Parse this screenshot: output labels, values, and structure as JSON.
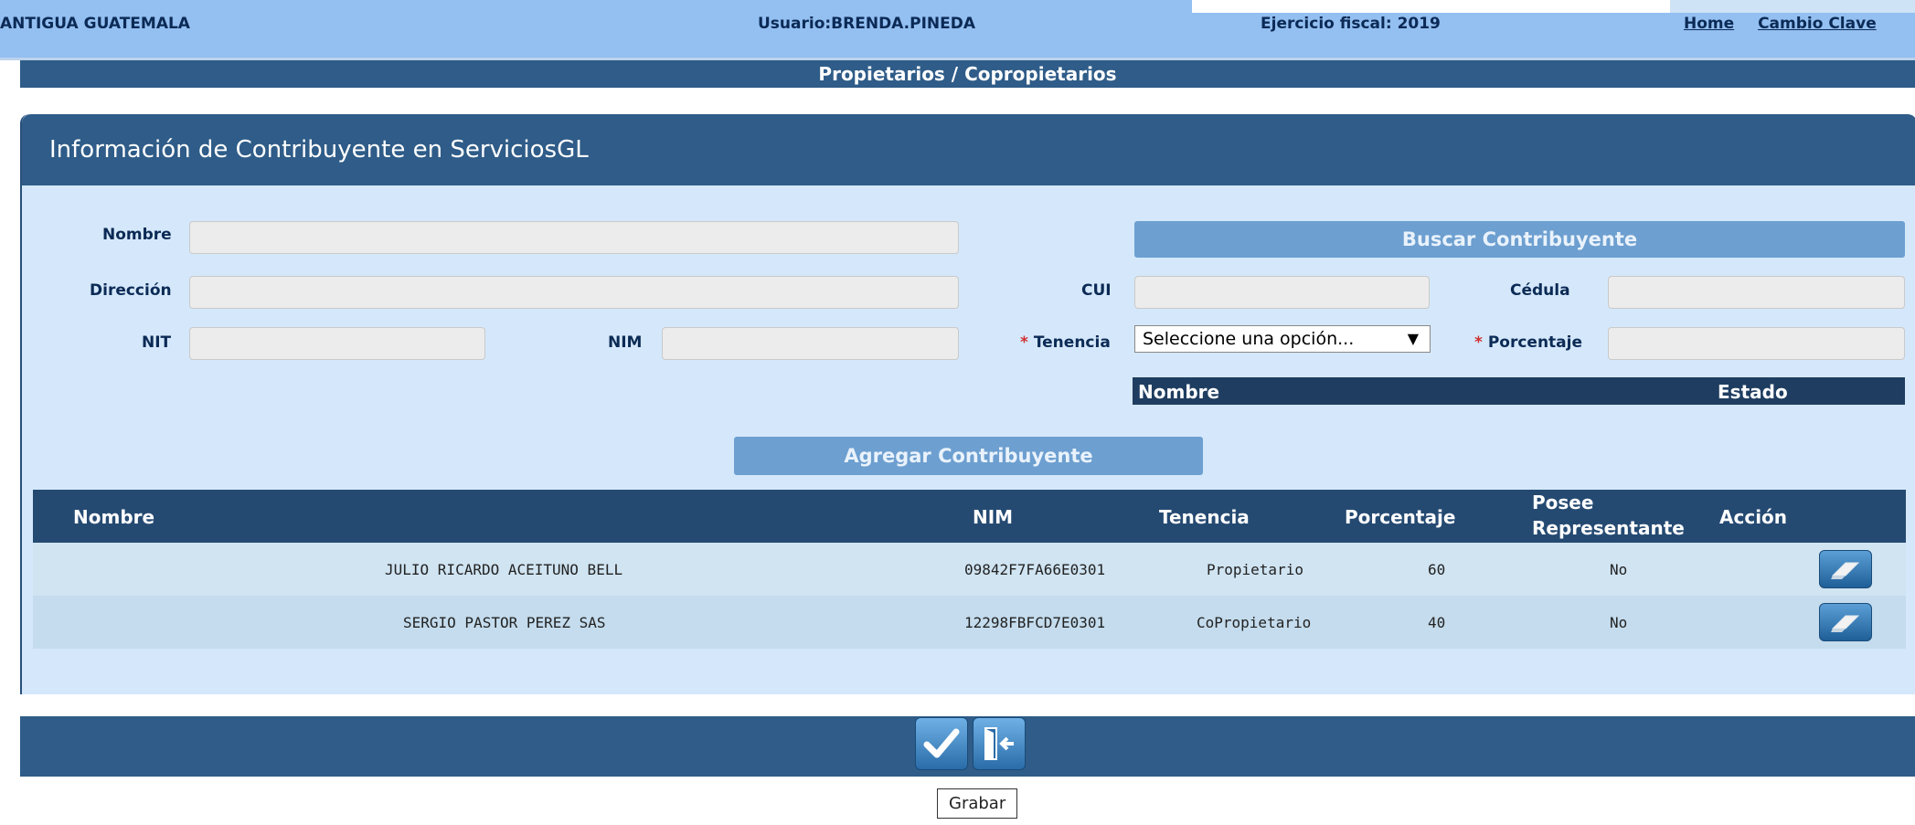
{
  "header": {
    "site": "ANTIGUA GUATEMALA",
    "user": "Usuario:BRENDA.PINEDA",
    "fiscal_year": "Ejercicio fiscal: 2019",
    "link_home": "Home",
    "link_change_key": "Cambio Clave"
  },
  "section_title": "Propietarios / Copropietarios",
  "panel": {
    "title": "Información de Contribuyente en ServiciosGL"
  },
  "form": {
    "nombre_label": "Nombre",
    "direccion_label": "Dirección",
    "nit_label": "NIT",
    "nim_label": "NIM",
    "cui_label": "CUI",
    "cedula_label": "Cédula",
    "tenencia_label": "Tenencia",
    "porcentaje_label": "Porcentaje",
    "required_mark": "*",
    "tenencia_select_value": "Seleccione una opción...",
    "search_button": "Buscar Contribuyente",
    "add_button": "Agregar Contribuyente"
  },
  "mini_table": {
    "col_nombre": "Nombre",
    "col_estado": "Estado"
  },
  "grid": {
    "headers": {
      "nombre": "Nombre",
      "nim": "NIM",
      "tenencia": "Tenencia",
      "porcentaje": "Porcentaje",
      "posee": "Posee",
      "representante": "Representante",
      "accion": "Acción"
    },
    "rows": [
      {
        "nombre": "JULIO RICARDO ACEITUNO BELL",
        "nim": "09842F7FA66E0301",
        "tenencia": "Propietario",
        "porcentaje": "60",
        "posee": "No"
      },
      {
        "nombre": "SERGIO PASTOR PEREZ SAS",
        "nim": "12298FBFCD7E0301",
        "tenencia": "CoPropietario",
        "porcentaje": "40",
        "posee": "No"
      }
    ]
  },
  "footer": {
    "tooltip": "Grabar",
    "icons": [
      "check-icon",
      "exit-door-icon",
      "eraser-icon"
    ]
  },
  "colors": {
    "header_bg": "#93bff1",
    "dark_blue": "#2f5c88",
    "panel_bg": "#d5e8fb",
    "required": "#d03030"
  }
}
